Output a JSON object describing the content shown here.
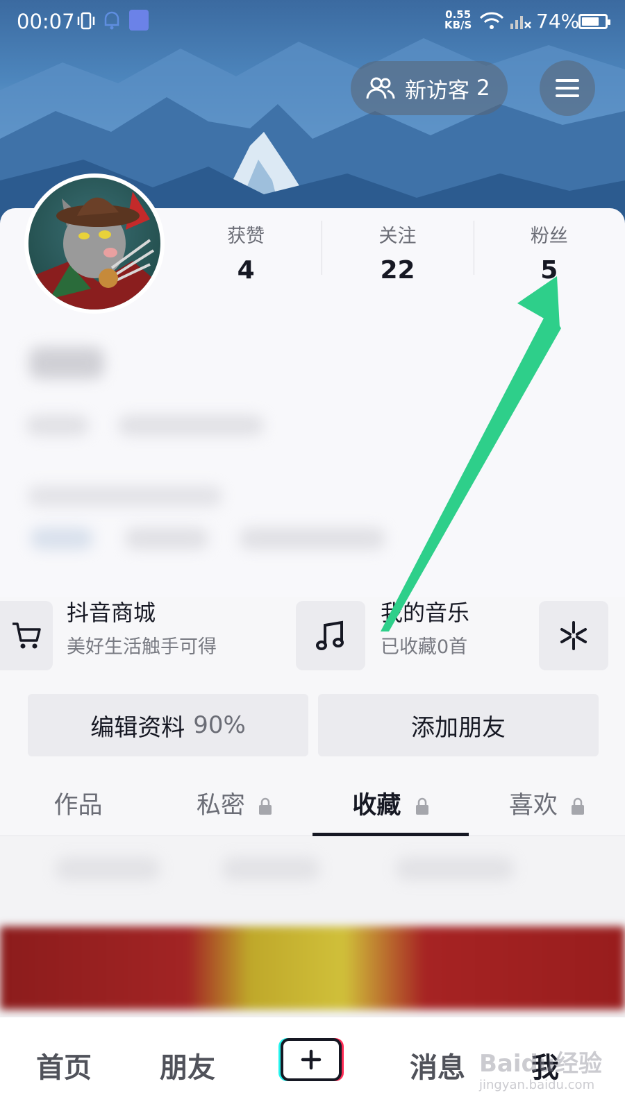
{
  "status_bar": {
    "time": "00:07",
    "speed_value": "0.55",
    "speed_unit": "KB/S",
    "battery": "74%",
    "battery_level": 0.74
  },
  "header": {
    "visitors_label": "新访客",
    "visitors_count": "2"
  },
  "stats": [
    {
      "label": "获赞",
      "value": "4"
    },
    {
      "label": "关注",
      "value": "22"
    },
    {
      "label": "粉丝",
      "value": "5"
    }
  ],
  "services": [
    {
      "title": "抖音商城",
      "subtitle": "美好生活触手可得",
      "icon": "cart-icon"
    },
    {
      "title": "我的音乐",
      "subtitle": "已收藏0首",
      "icon": "music-note-icon"
    },
    {
      "title": "",
      "subtitle": "",
      "icon": "sparkle-icon"
    }
  ],
  "actions": {
    "edit_label": "编辑资料",
    "edit_percent": "90%",
    "add_friend_label": "添加朋友"
  },
  "tabs": [
    {
      "label": "作品",
      "locked": false
    },
    {
      "label": "私密",
      "locked": true
    },
    {
      "label": "收藏",
      "locked": true,
      "active": true
    },
    {
      "label": "喜欢",
      "locked": true
    }
  ],
  "bottom_nav": {
    "home": "首页",
    "friends": "朋友",
    "messages": "消息",
    "me": "我"
  },
  "watermark": {
    "main": "Baidu经验",
    "sub": "jingyan.baidu.com"
  },
  "colors": {
    "annotation_arrow": "#2ecf8a",
    "text_primary": "#161823",
    "text_secondary": "#6b6d76"
  }
}
